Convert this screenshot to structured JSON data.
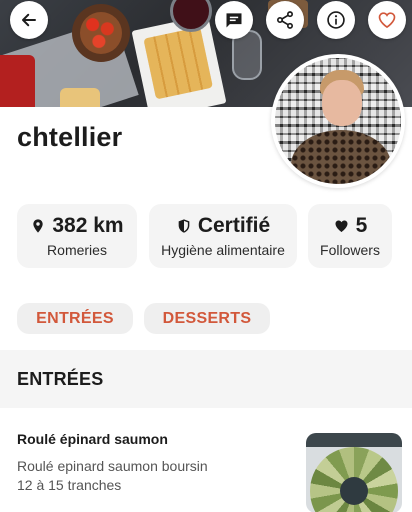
{
  "header": {
    "buttons": [
      {
        "icon": "back-arrow-icon"
      },
      {
        "icon": "message-icon"
      },
      {
        "icon": "share-icon"
      },
      {
        "icon": "info-icon"
      },
      {
        "icon": "heart-icon"
      }
    ],
    "accent_color": "#d2583b"
  },
  "profile": {
    "username": "chtellier"
  },
  "stats": [
    {
      "icon": "location-pin-icon",
      "value": "382 km",
      "label": "Romeries"
    },
    {
      "icon": "shield-icon",
      "value": "Certifié",
      "label": "Hygiène alimentaire"
    },
    {
      "icon": "heart-filled-icon",
      "value": "5",
      "label": "Followers"
    }
  ],
  "categories": [
    {
      "label": "ENTRÉES"
    },
    {
      "label": "DESSERTS"
    }
  ],
  "section": {
    "title": "ENTRÉES"
  },
  "recipes": [
    {
      "title": "Roulé épinard saumon",
      "description_line1": "Roulé epinard saumon boursin",
      "description_line2": "12 à 15 tranches"
    }
  ]
}
